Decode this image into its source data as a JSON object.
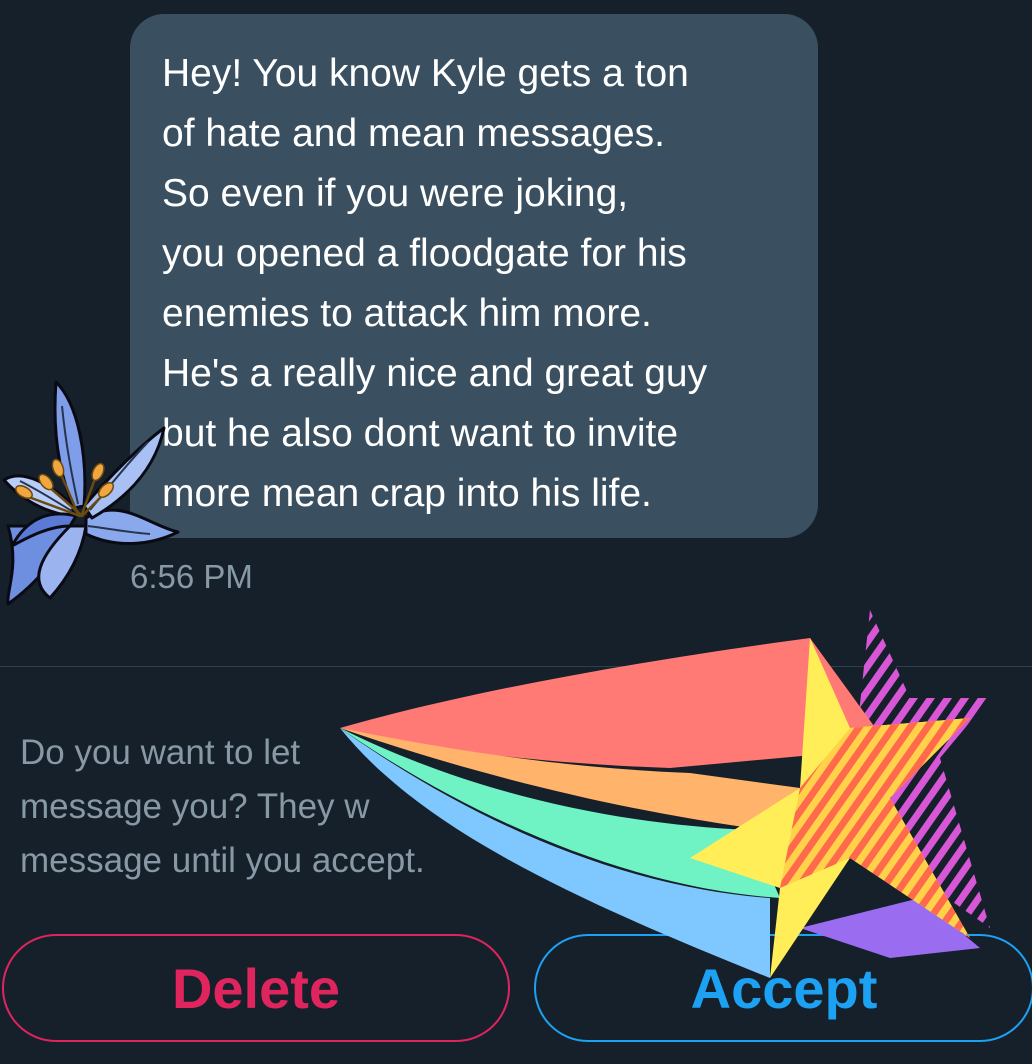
{
  "message": {
    "lines": [
      "Hey! You know Kyle gets a ton",
      "of hate and mean messages.",
      "So even if you were joking,",
      "you opened a floodgate for his",
      "enemies to attack him more.",
      "He's a really nice and great guy",
      "but he also dont want to invite",
      "more mean crap into his life."
    ],
    "timestamp": "6:56 PM"
  },
  "request": {
    "lines": [
      "Do you want to let",
      "message you? They w",
      "message until you accept."
    ]
  },
  "buttons": {
    "delete_label": "Delete",
    "accept_label": "Accept"
  },
  "colors": {
    "background": "#15202b",
    "bubble": "#3a5060",
    "muted_text": "#8899a6",
    "delete": "#e0245e",
    "accept": "#1da1f2"
  },
  "stickers": {
    "flower_icon": "blue-lily-sticker",
    "star_icon": "rainbow-shooting-star-sticker"
  }
}
